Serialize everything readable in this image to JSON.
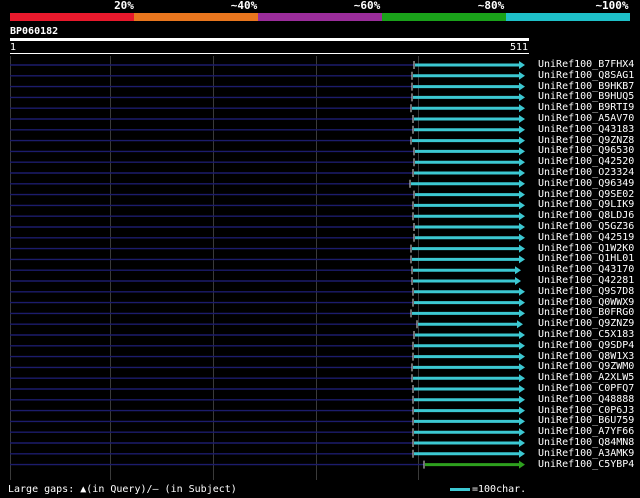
{
  "legend": {
    "colors": [
      "#e8192c",
      "#e8761e",
      "#9b2d9b",
      "#1aa21a",
      "#1ec0c8"
    ],
    "labels": [
      "20%",
      "~40%",
      "~60%",
      "~80%",
      "~100%"
    ]
  },
  "query": {
    "id": "BP060182",
    "start": "1",
    "end": "511"
  },
  "hits": [
    {
      "name": "UniRef100_B7FHX4",
      "color": "#3cc8d2"
    },
    {
      "name": "UniRef100_Q8SAG1",
      "color": "#3cc8d2"
    },
    {
      "name": "UniRef100_B9HKB7",
      "color": "#3cc8d2"
    },
    {
      "name": "UniRef100_B9HUQ5",
      "color": "#3cc8d2"
    },
    {
      "name": "UniRef100_B9RTI9",
      "color": "#3cc8d2"
    },
    {
      "name": "UniRef100_A5AV70",
      "color": "#3cc8d2"
    },
    {
      "name": "UniRef100_Q43183",
      "color": "#3cc8d2"
    },
    {
      "name": "UniRef100_Q9ZNZ8",
      "color": "#3cc8d2"
    },
    {
      "name": "UniRef100_Q96530",
      "color": "#3cc8d2"
    },
    {
      "name": "UniRef100_Q42520",
      "color": "#3cc8d2"
    },
    {
      "name": "UniRef100_O23324",
      "color": "#3cc8d2"
    },
    {
      "name": "UniRef100_Q96349",
      "color": "#3cc8d2"
    },
    {
      "name": "UniRef100_Q9SE02",
      "color": "#3cc8d2"
    },
    {
      "name": "UniRef100_Q9LIK9",
      "color": "#3cc8d2"
    },
    {
      "name": "UniRef100_Q8LDJ6",
      "color": "#3cc8d2"
    },
    {
      "name": "UniRef100_Q5GZ36",
      "color": "#3cc8d2"
    },
    {
      "name": "UniRef100_Q42519",
      "color": "#3cc8d2"
    },
    {
      "name": "UniRef100_Q1W2K0",
      "color": "#3cc8d2"
    },
    {
      "name": "UniRef100_Q1HL01",
      "color": "#3cc8d2"
    },
    {
      "name": "UniRef100_Q43170",
      "color": "#3cc8d2"
    },
    {
      "name": "UniRef100_Q42281",
      "color": "#3cc8d2"
    },
    {
      "name": "UniRef100_Q9S7D8",
      "color": "#3cc8d2"
    },
    {
      "name": "UniRef100_Q0WWX9",
      "color": "#3cc8d2"
    },
    {
      "name": "UniRef100_B0FRG0",
      "color": "#3cc8d2"
    },
    {
      "name": "UniRef100_Q9ZNZ9",
      "color": "#3cc8d2"
    },
    {
      "name": "UniRef100_C5X183",
      "color": "#3cc8d2"
    },
    {
      "name": "UniRef100_Q9SDP4",
      "color": "#3cc8d2"
    },
    {
      "name": "UniRef100_Q8W1X3",
      "color": "#3cc8d2"
    },
    {
      "name": "UniRef100_Q9ZWM0",
      "color": "#3cc8d2"
    },
    {
      "name": "UniRef100_A2XLW5",
      "color": "#3cc8d2"
    },
    {
      "name": "UniRef100_C0PFQ7",
      "color": "#3cc8d2"
    },
    {
      "name": "UniRef100_Q48888",
      "color": "#3cc8d2"
    },
    {
      "name": "UniRef100_C0P6J3",
      "color": "#3cc8d2"
    },
    {
      "name": "UniRef100_B6U759",
      "color": "#3cc8d2"
    },
    {
      "name": "UniRef100_A7YF66",
      "color": "#3cc8d2"
    },
    {
      "name": "UniRef100_Q84MN8",
      "color": "#3cc8d2"
    },
    {
      "name": "UniRef100_A3AMK9",
      "color": "#3cc8d2"
    },
    {
      "name": "UniRef100_C5YBP4",
      "color": "#2ea01e"
    }
  ],
  "footer": {
    "gaps_label": "Large gaps:",
    "gaps_query": "▲(in Query)/",
    "gaps_subject": "– (in Subject)",
    "scale_label": "=100char."
  }
}
